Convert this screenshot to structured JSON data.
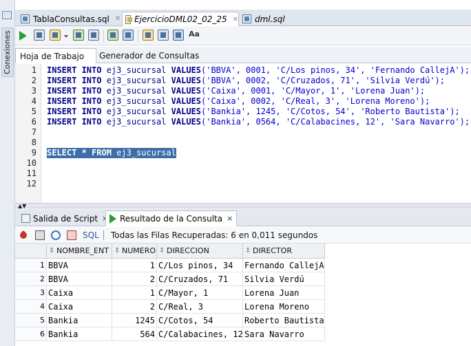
{
  "left_panel": {
    "label": "Conexiones"
  },
  "file_tabs": [
    {
      "label": "TablaConsultas.sql"
    },
    {
      "label": "EjercicioDML02_02_25"
    },
    {
      "label": "dml.sql"
    }
  ],
  "sub_tabs": {
    "worksheet": "Hoja de Trabajo",
    "query_builder": "Generador de Consultas"
  },
  "editor": {
    "line_numbers": [
      "1",
      "2",
      "3",
      "4",
      "5",
      "6",
      "7",
      "8",
      "9",
      "10",
      "11",
      "12"
    ],
    "lines": [
      {
        "kw1": "INSERT INTO",
        "tbl": " ej3_sucursal ",
        "kw2": "VALUES",
        "vals": "('BBVA', 0001, 'C/Los pinos, 34', 'Fernando CallejA');"
      },
      {
        "kw1": "INSERT INTO",
        "tbl": " ej3_sucursal ",
        "kw2": "VALUES",
        "vals": "('BBVA', 0002, 'C/Cruzados, 71', 'Silvia Verdú');"
      },
      {
        "kw1": "INSERT INTO",
        "tbl": " ej3_sucursal ",
        "kw2": "VALUES",
        "vals": "('Caixa', 0001, 'C/Mayor, 1', 'Lorena Juan');"
      },
      {
        "kw1": "INSERT INTO",
        "tbl": " ej3_sucursal ",
        "kw2": "VALUES",
        "vals": "('Caixa', 0002, 'C/Real, 3', 'Lorena Moreno');"
      },
      {
        "kw1": "INSERT INTO",
        "tbl": " ej3_sucursal ",
        "kw2": "VALUES",
        "vals": "('Bankia', 1245, 'C/Cotos, 54', 'Roberto Bautista');"
      },
      {
        "kw1": "INSERT INTO",
        "tbl": " ej3_sucursal ",
        "kw2": "VALUES",
        "vals": "('Bankia', 0564, 'C/Calabacines, 12', 'Sara Navarro');"
      }
    ],
    "select_line": {
      "kw1": "SELECT * FROM",
      "tbl": " ej3_sucursal"
    }
  },
  "toolbar": {
    "format_label": "Aa"
  },
  "output_tabs": {
    "script_output": "Salida de Script",
    "query_result": "Resultado de la Consulta"
  },
  "result_toolbar": {
    "sql": "SQL",
    "status": "Todas las Filas Recuperadas: 6 en 0,011 segundos"
  },
  "result_grid": {
    "columns": [
      "NOMBRE_ENT",
      "NUMERO",
      "DIRECCION",
      "DIRECTOR"
    ],
    "rows": [
      {
        "n": "1",
        "nombre": "BBVA",
        "numero": "1",
        "direccion": "C/Los pinos, 34",
        "director": "Fernando CallejA"
      },
      {
        "n": "2",
        "nombre": "BBVA",
        "numero": "2",
        "direccion": "C/Cruzados, 71",
        "director": "Silvia Verdú"
      },
      {
        "n": "3",
        "nombre": "Caixa",
        "numero": "1",
        "direccion": "C/Mayor, 1",
        "director": "Lorena Juan"
      },
      {
        "n": "4",
        "nombre": "Caixa",
        "numero": "2",
        "direccion": "C/Real, 3",
        "director": "Lorena Moreno"
      },
      {
        "n": "5",
        "nombre": "Bankia",
        "numero": "1245",
        "direccion": "C/Cotos, 54",
        "director": "Roberto Bautista"
      },
      {
        "n": "6",
        "nombre": "Bankia",
        "numero": "564",
        "direccion": "C/Calabacines, 12",
        "director": "Sara Navarro"
      }
    ]
  }
}
